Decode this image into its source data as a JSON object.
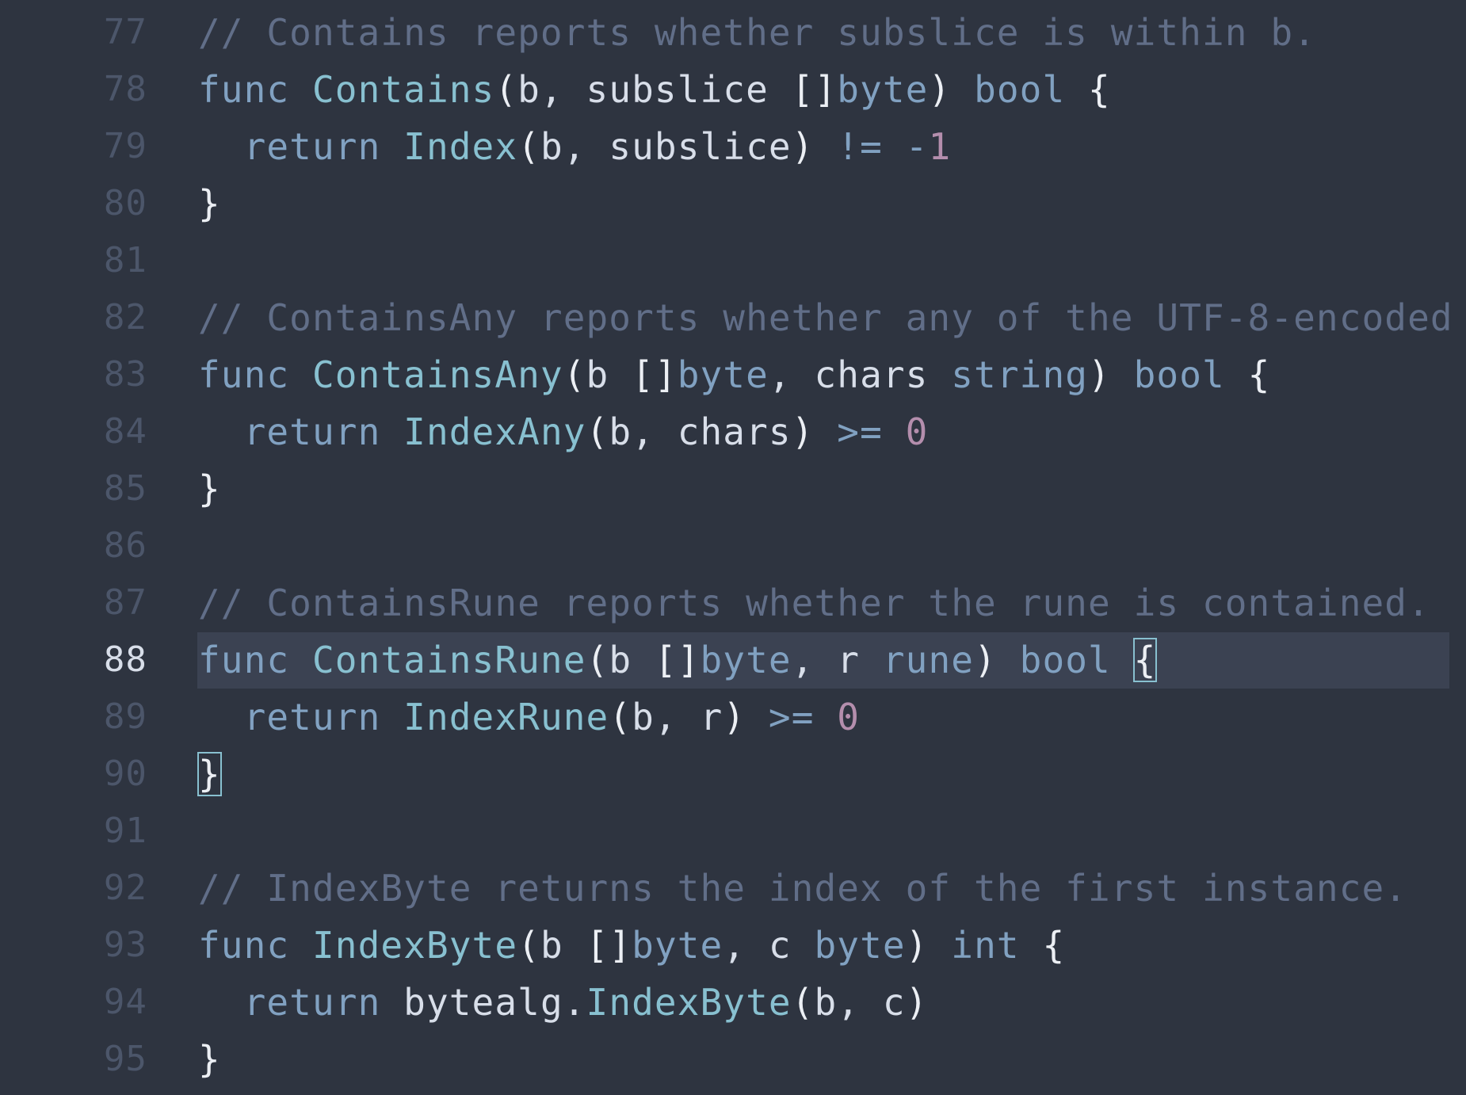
{
  "editor": {
    "theme_colors": {
      "background": "#2E3440",
      "current_line": "#3B4252",
      "gutter": "#4C566A",
      "gutter_active": "#D8DEE9",
      "comment": "#616E88",
      "keyword": "#81A1C1",
      "function": "#88C0D0",
      "number": "#B48EAD",
      "text": "#D8DEE9",
      "bracket_match": "#88C0D0"
    },
    "active_line": 88,
    "matched_brackets": [
      {
        "line": 88,
        "char": "{"
      },
      {
        "line": 90,
        "char": "}"
      }
    ],
    "lines": [
      {
        "number": "77",
        "tokens": [
          {
            "t": "// Contains reports whether subslice is within b.",
            "k": "comment"
          }
        ]
      },
      {
        "number": "78",
        "tokens": [
          {
            "t": "func",
            "k": "keyword"
          },
          {
            "t": " ",
            "k": "text"
          },
          {
            "t": "Contains",
            "k": "func"
          },
          {
            "t": "(",
            "k": "punct"
          },
          {
            "t": "b, subslice ",
            "k": "text"
          },
          {
            "t": "[]",
            "k": "punct"
          },
          {
            "t": "byte",
            "k": "type"
          },
          {
            "t": ")",
            "k": "punct"
          },
          {
            "t": " ",
            "k": "text"
          },
          {
            "t": "bool",
            "k": "type"
          },
          {
            "t": " ",
            "k": "text"
          },
          {
            "t": "{",
            "k": "punct"
          }
        ]
      },
      {
        "number": "79",
        "tokens": [
          {
            "t": "  ",
            "k": "text"
          },
          {
            "t": "return",
            "k": "keyword"
          },
          {
            "t": " ",
            "k": "text"
          },
          {
            "t": "Index",
            "k": "func"
          },
          {
            "t": "(",
            "k": "punct"
          },
          {
            "t": "b, subslice",
            "k": "text"
          },
          {
            "t": ")",
            "k": "punct"
          },
          {
            "t": " ",
            "k": "text"
          },
          {
            "t": "!=",
            "k": "op"
          },
          {
            "t": " ",
            "k": "text"
          },
          {
            "t": "-",
            "k": "op"
          },
          {
            "t": "1",
            "k": "number"
          }
        ]
      },
      {
        "number": "80",
        "tokens": [
          {
            "t": "}",
            "k": "punct"
          }
        ]
      },
      {
        "number": "81",
        "tokens": []
      },
      {
        "number": "82",
        "tokens": [
          {
            "t": "// ContainsAny reports whether any of the UTF-8-encoded",
            "k": "comment"
          }
        ]
      },
      {
        "number": "83",
        "tokens": [
          {
            "t": "func",
            "k": "keyword"
          },
          {
            "t": " ",
            "k": "text"
          },
          {
            "t": "ContainsAny",
            "k": "func"
          },
          {
            "t": "(",
            "k": "punct"
          },
          {
            "t": "b ",
            "k": "text"
          },
          {
            "t": "[]",
            "k": "punct"
          },
          {
            "t": "byte",
            "k": "type"
          },
          {
            "t": ", chars ",
            "k": "text"
          },
          {
            "t": "string",
            "k": "type"
          },
          {
            "t": ")",
            "k": "punct"
          },
          {
            "t": " ",
            "k": "text"
          },
          {
            "t": "bool",
            "k": "type"
          },
          {
            "t": " ",
            "k": "text"
          },
          {
            "t": "{",
            "k": "punct"
          }
        ]
      },
      {
        "number": "84",
        "tokens": [
          {
            "t": "  ",
            "k": "text"
          },
          {
            "t": "return",
            "k": "keyword"
          },
          {
            "t": " ",
            "k": "text"
          },
          {
            "t": "IndexAny",
            "k": "func"
          },
          {
            "t": "(",
            "k": "punct"
          },
          {
            "t": "b, chars",
            "k": "text"
          },
          {
            "t": ")",
            "k": "punct"
          },
          {
            "t": " ",
            "k": "text"
          },
          {
            "t": ">=",
            "k": "op"
          },
          {
            "t": " ",
            "k": "text"
          },
          {
            "t": "0",
            "k": "number"
          }
        ]
      },
      {
        "number": "85",
        "tokens": [
          {
            "t": "}",
            "k": "punct"
          }
        ]
      },
      {
        "number": "86",
        "tokens": []
      },
      {
        "number": "87",
        "tokens": [
          {
            "t": "// ContainsRune reports whether the rune is contained.",
            "k": "comment"
          }
        ]
      },
      {
        "number": "88",
        "tokens": [
          {
            "t": "func",
            "k": "keyword"
          },
          {
            "t": " ",
            "k": "text"
          },
          {
            "t": "ContainsRune",
            "k": "func"
          },
          {
            "t": "(",
            "k": "punct"
          },
          {
            "t": "b ",
            "k": "text"
          },
          {
            "t": "[]",
            "k": "punct"
          },
          {
            "t": "byte",
            "k": "type"
          },
          {
            "t": ", r ",
            "k": "text"
          },
          {
            "t": "rune",
            "k": "type"
          },
          {
            "t": ")",
            "k": "punct"
          },
          {
            "t": " ",
            "k": "text"
          },
          {
            "t": "bool",
            "k": "type"
          },
          {
            "t": " ",
            "k": "text"
          },
          {
            "t": "{",
            "k": "bracket-match"
          }
        ]
      },
      {
        "number": "89",
        "tokens": [
          {
            "t": "  ",
            "k": "text"
          },
          {
            "t": "return",
            "k": "keyword"
          },
          {
            "t": " ",
            "k": "text"
          },
          {
            "t": "IndexRune",
            "k": "func"
          },
          {
            "t": "(",
            "k": "punct"
          },
          {
            "t": "b, r",
            "k": "text"
          },
          {
            "t": ")",
            "k": "punct"
          },
          {
            "t": " ",
            "k": "text"
          },
          {
            "t": ">=",
            "k": "op"
          },
          {
            "t": " ",
            "k": "text"
          },
          {
            "t": "0",
            "k": "number"
          }
        ]
      },
      {
        "number": "90",
        "tokens": [
          {
            "t": "}",
            "k": "bracket-match"
          }
        ]
      },
      {
        "number": "91",
        "tokens": []
      },
      {
        "number": "92",
        "tokens": [
          {
            "t": "// IndexByte returns the index of the first instance.",
            "k": "comment"
          }
        ]
      },
      {
        "number": "93",
        "tokens": [
          {
            "t": "func",
            "k": "keyword"
          },
          {
            "t": " ",
            "k": "text"
          },
          {
            "t": "IndexByte",
            "k": "func"
          },
          {
            "t": "(",
            "k": "punct"
          },
          {
            "t": "b ",
            "k": "text"
          },
          {
            "t": "[]",
            "k": "punct"
          },
          {
            "t": "byte",
            "k": "type"
          },
          {
            "t": ", c ",
            "k": "text"
          },
          {
            "t": "byte",
            "k": "type"
          },
          {
            "t": ")",
            "k": "punct"
          },
          {
            "t": " ",
            "k": "text"
          },
          {
            "t": "int",
            "k": "type"
          },
          {
            "t": " ",
            "k": "text"
          },
          {
            "t": "{",
            "k": "punct"
          }
        ]
      },
      {
        "number": "94",
        "tokens": [
          {
            "t": "  ",
            "k": "text"
          },
          {
            "t": "return",
            "k": "keyword"
          },
          {
            "t": " ",
            "k": "text"
          },
          {
            "t": "bytealg.",
            "k": "text"
          },
          {
            "t": "IndexByte",
            "k": "func"
          },
          {
            "t": "(",
            "k": "punct"
          },
          {
            "t": "b, c",
            "k": "text"
          },
          {
            "t": ")",
            "k": "punct"
          }
        ]
      },
      {
        "number": "95",
        "tokens": [
          {
            "t": "}",
            "k": "punct"
          }
        ]
      }
    ]
  }
}
